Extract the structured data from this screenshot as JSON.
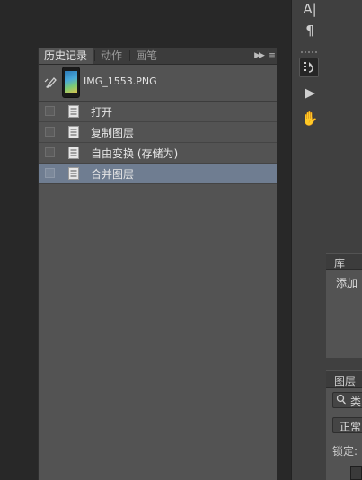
{
  "history_panel": {
    "tabs": [
      {
        "label": "历史记录",
        "active": true
      },
      {
        "label": "动作",
        "active": false
      },
      {
        "label": "画笔",
        "active": false
      }
    ],
    "collapse_icon": "double-arrow-right-icon",
    "menu_icon": "panel-menu-icon",
    "snapshot": {
      "label": "IMG_1553.PNG",
      "icon": "history-brush-icon"
    },
    "steps": [
      {
        "label": "打开",
        "selected": false
      },
      {
        "label": "复制图层",
        "selected": false
      },
      {
        "label": "自由变换 (存储为)",
        "selected": false
      },
      {
        "label": "合并图层",
        "selected": true
      }
    ]
  },
  "toolbar": {
    "tools": [
      {
        "name": "character-icon",
        "glyph": "A|"
      },
      {
        "name": "paragraph-icon",
        "glyph": "¶"
      },
      {
        "name": "history-icon",
        "glyph": "↺"
      },
      {
        "name": "actions-play-icon",
        "glyph": "▶"
      },
      {
        "name": "brush-preset-icon",
        "glyph": "✋"
      }
    ]
  },
  "library_panel": {
    "tab": "库",
    "add_text": "添加"
  },
  "layers_panel": {
    "tab": "图层",
    "search_text": "类",
    "blend_mode": "正常",
    "lock_label": "锁定:"
  },
  "colors": {
    "panel": "#535353",
    "tab_bar": "#3c3c3c",
    "selected_row": "#6f7d91",
    "background": "#282828"
  }
}
